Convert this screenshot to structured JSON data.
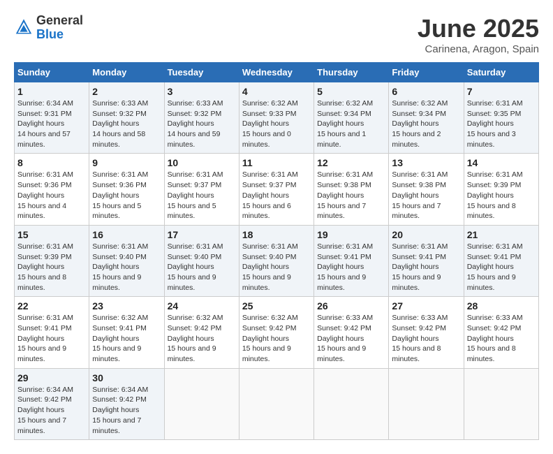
{
  "header": {
    "logo": {
      "general": "General",
      "blue": "Blue"
    },
    "title": "June 2025",
    "location": "Carinena, Aragon, Spain"
  },
  "weekdays": [
    "Sunday",
    "Monday",
    "Tuesday",
    "Wednesday",
    "Thursday",
    "Friday",
    "Saturday"
  ],
  "weeks": [
    [
      {
        "day": "1",
        "sunrise": "6:34 AM",
        "sunset": "9:31 PM",
        "daylight": "14 hours and 57 minutes."
      },
      {
        "day": "2",
        "sunrise": "6:33 AM",
        "sunset": "9:32 PM",
        "daylight": "14 hours and 58 minutes."
      },
      {
        "day": "3",
        "sunrise": "6:33 AM",
        "sunset": "9:32 PM",
        "daylight": "14 hours and 59 minutes."
      },
      {
        "day": "4",
        "sunrise": "6:32 AM",
        "sunset": "9:33 PM",
        "daylight": "15 hours and 0 minutes."
      },
      {
        "day": "5",
        "sunrise": "6:32 AM",
        "sunset": "9:34 PM",
        "daylight": "15 hours and 1 minute."
      },
      {
        "day": "6",
        "sunrise": "6:32 AM",
        "sunset": "9:34 PM",
        "daylight": "15 hours and 2 minutes."
      },
      {
        "day": "7",
        "sunrise": "6:31 AM",
        "sunset": "9:35 PM",
        "daylight": "15 hours and 3 minutes."
      }
    ],
    [
      {
        "day": "8",
        "sunrise": "6:31 AM",
        "sunset": "9:36 PM",
        "daylight": "15 hours and 4 minutes."
      },
      {
        "day": "9",
        "sunrise": "6:31 AM",
        "sunset": "9:36 PM",
        "daylight": "15 hours and 5 minutes."
      },
      {
        "day": "10",
        "sunrise": "6:31 AM",
        "sunset": "9:37 PM",
        "daylight": "15 hours and 5 minutes."
      },
      {
        "day": "11",
        "sunrise": "6:31 AM",
        "sunset": "9:37 PM",
        "daylight": "15 hours and 6 minutes."
      },
      {
        "day": "12",
        "sunrise": "6:31 AM",
        "sunset": "9:38 PM",
        "daylight": "15 hours and 7 minutes."
      },
      {
        "day": "13",
        "sunrise": "6:31 AM",
        "sunset": "9:38 PM",
        "daylight": "15 hours and 7 minutes."
      },
      {
        "day": "14",
        "sunrise": "6:31 AM",
        "sunset": "9:39 PM",
        "daylight": "15 hours and 8 minutes."
      }
    ],
    [
      {
        "day": "15",
        "sunrise": "6:31 AM",
        "sunset": "9:39 PM",
        "daylight": "15 hours and 8 minutes."
      },
      {
        "day": "16",
        "sunrise": "6:31 AM",
        "sunset": "9:40 PM",
        "daylight": "15 hours and 9 minutes."
      },
      {
        "day": "17",
        "sunrise": "6:31 AM",
        "sunset": "9:40 PM",
        "daylight": "15 hours and 9 minutes."
      },
      {
        "day": "18",
        "sunrise": "6:31 AM",
        "sunset": "9:40 PM",
        "daylight": "15 hours and 9 minutes."
      },
      {
        "day": "19",
        "sunrise": "6:31 AM",
        "sunset": "9:41 PM",
        "daylight": "15 hours and 9 minutes."
      },
      {
        "day": "20",
        "sunrise": "6:31 AM",
        "sunset": "9:41 PM",
        "daylight": "15 hours and 9 minutes."
      },
      {
        "day": "21",
        "sunrise": "6:31 AM",
        "sunset": "9:41 PM",
        "daylight": "15 hours and 9 minutes."
      }
    ],
    [
      {
        "day": "22",
        "sunrise": "6:31 AM",
        "sunset": "9:41 PM",
        "daylight": "15 hours and 9 minutes."
      },
      {
        "day": "23",
        "sunrise": "6:32 AM",
        "sunset": "9:41 PM",
        "daylight": "15 hours and 9 minutes."
      },
      {
        "day": "24",
        "sunrise": "6:32 AM",
        "sunset": "9:42 PM",
        "daylight": "15 hours and 9 minutes."
      },
      {
        "day": "25",
        "sunrise": "6:32 AM",
        "sunset": "9:42 PM",
        "daylight": "15 hours and 9 minutes."
      },
      {
        "day": "26",
        "sunrise": "6:33 AM",
        "sunset": "9:42 PM",
        "daylight": "15 hours and 9 minutes."
      },
      {
        "day": "27",
        "sunrise": "6:33 AM",
        "sunset": "9:42 PM",
        "daylight": "15 hours and 8 minutes."
      },
      {
        "day": "28",
        "sunrise": "6:33 AM",
        "sunset": "9:42 PM",
        "daylight": "15 hours and 8 minutes."
      }
    ],
    [
      {
        "day": "29",
        "sunrise": "6:34 AM",
        "sunset": "9:42 PM",
        "daylight": "15 hours and 7 minutes."
      },
      {
        "day": "30",
        "sunrise": "6:34 AM",
        "sunset": "9:42 PM",
        "daylight": "15 hours and 7 minutes."
      },
      null,
      null,
      null,
      null,
      null
    ]
  ]
}
